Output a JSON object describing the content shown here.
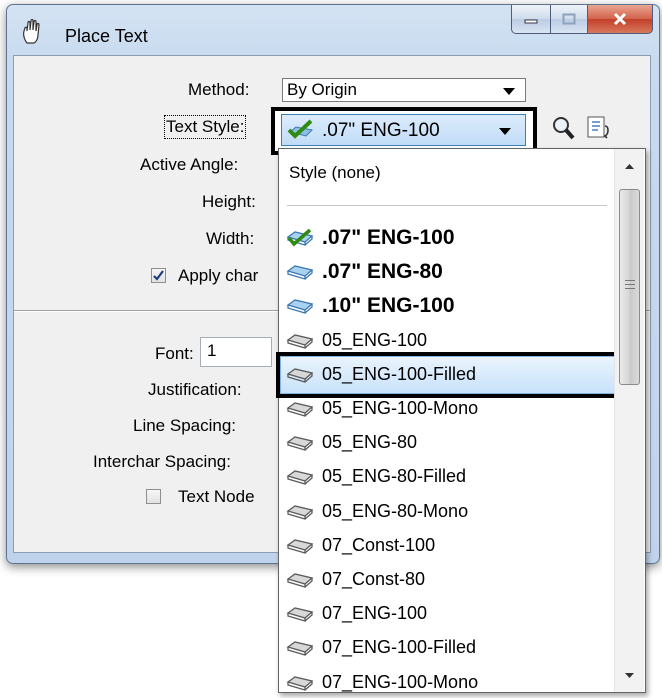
{
  "window": {
    "title": "Place Text"
  },
  "form": {
    "method_label": "Method:",
    "method_value": "By Origin",
    "text_style_label": "Text Style:",
    "text_style_value": ".07\"  ENG-100",
    "active_angle_label": "Active Angle:",
    "height_label": "Height:",
    "width_label": "Width:",
    "apply_changes_label": "Apply char",
    "apply_changes_checked": true,
    "font_label": "Font:",
    "font_value": "1",
    "justification_label": "Justification:",
    "line_spacing_label": "Line Spacing:",
    "interchar_spacing_label": "Interchar Spacing:",
    "text_node_label": "Text Node",
    "text_node_checked": false
  },
  "dropdown": {
    "none_item": "Style (none)",
    "items": [
      {
        "label": ".07\"  ENG-100",
        "icon": "checked-style-icon",
        "bold": true
      },
      {
        "label": ".07\"  ENG-80",
        "icon": "style-icon-blue",
        "bold": true
      },
      {
        "label": ".10\"  ENG-100",
        "icon": "style-icon-blue",
        "bold": true
      },
      {
        "label": "05_ENG-100",
        "icon": "style-icon-gray",
        "bold": false
      },
      {
        "label": "05_ENG-100-Filled",
        "icon": "style-icon-gray",
        "bold": false
      },
      {
        "label": "05_ENG-100-Mono",
        "icon": "style-icon-gray",
        "bold": false
      },
      {
        "label": "05_ENG-80",
        "icon": "style-icon-gray",
        "bold": false
      },
      {
        "label": "05_ENG-80-Filled",
        "icon": "style-icon-gray",
        "bold": false
      },
      {
        "label": "05_ENG-80-Mono",
        "icon": "style-icon-gray",
        "bold": false
      },
      {
        "label": "07_Const-100",
        "icon": "style-icon-gray",
        "bold": false
      },
      {
        "label": "07_Const-80",
        "icon": "style-icon-gray",
        "bold": false
      },
      {
        "label": "07_ENG-100",
        "icon": "style-icon-gray",
        "bold": false
      },
      {
        "label": "07_ENG-100-Filled",
        "icon": "style-icon-gray",
        "bold": false
      },
      {
        "label": "07_ENG-100-Mono",
        "icon": "style-icon-gray",
        "bold": false
      }
    ],
    "highlighted": "05_ENG-100-Filled"
  },
  "colors": {
    "selection": "#c8e2fa",
    "check_green": "#3a9a1a",
    "close_red": "#c2402a"
  }
}
